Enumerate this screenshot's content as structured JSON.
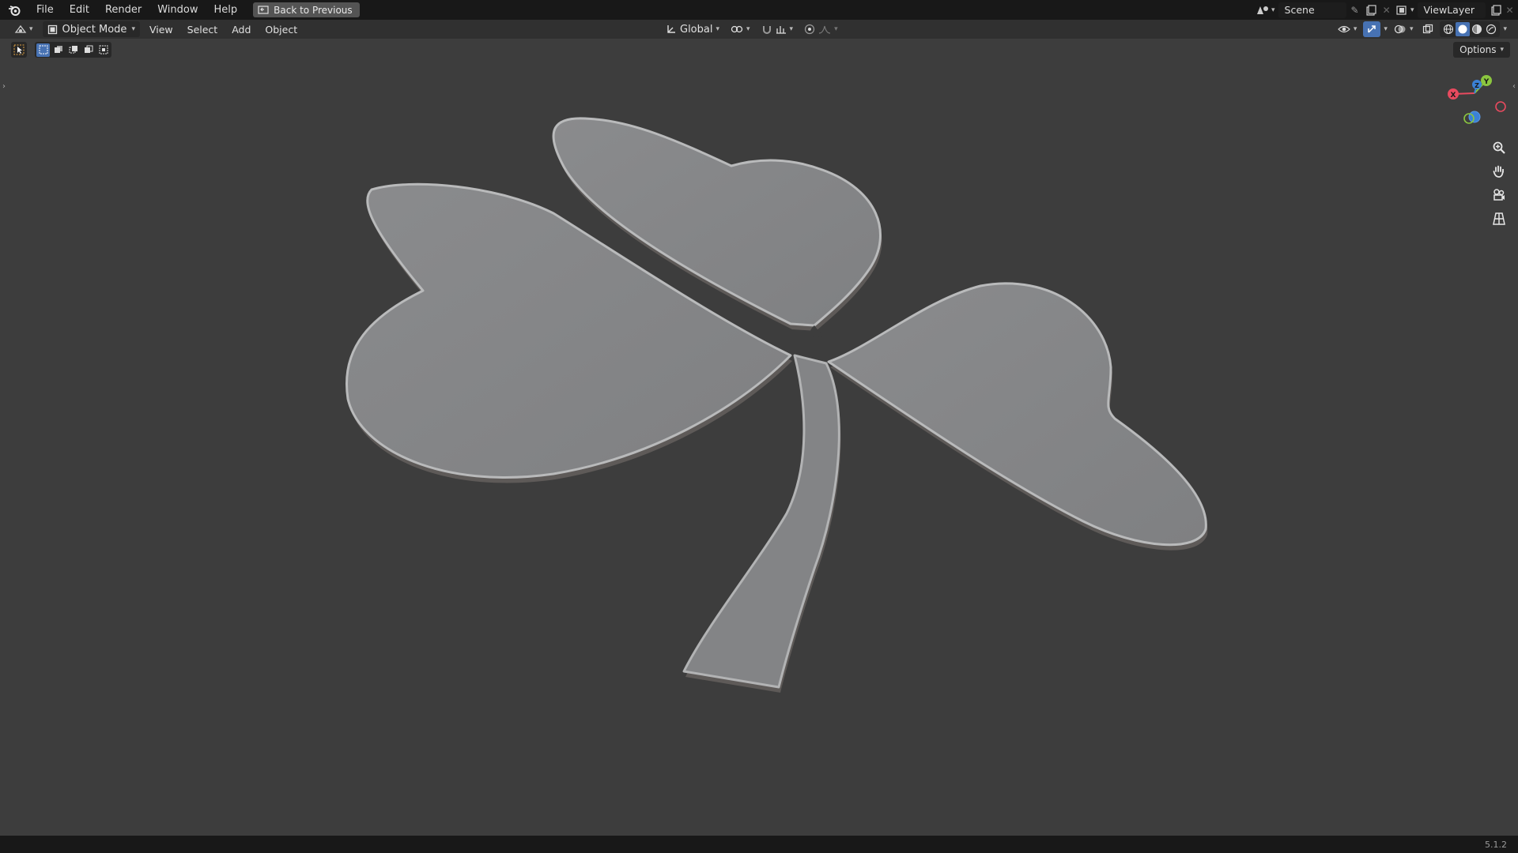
{
  "topbar": {
    "menu": [
      "File",
      "Edit",
      "Render",
      "Window",
      "Help"
    ],
    "back_button": "Back to Previous",
    "scene_name": "Scene",
    "view_layer": "ViewLayer"
  },
  "header": {
    "mode": "Object Mode",
    "menus": [
      "View",
      "Select",
      "Add",
      "Object"
    ],
    "transform_orientation": "Global",
    "options_label": "Options"
  },
  "viewport": {
    "object_name": "shamrock",
    "gizmo_axes": [
      "X",
      "Y",
      "Z"
    ]
  },
  "statusbar": {
    "version": "5.1.2"
  },
  "colors": {
    "accent": "#4772b3",
    "viewport_bg": "#3d3d3d",
    "axis_x": "#e84a5f",
    "axis_y": "#8bc63f",
    "axis_z": "#3b82d6"
  }
}
